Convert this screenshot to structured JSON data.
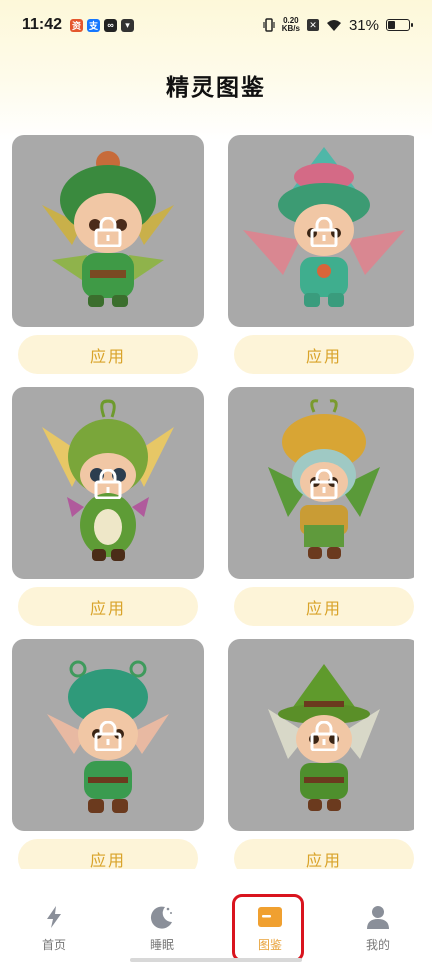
{
  "status_bar": {
    "time": "11:42",
    "net_speed_value": "0.20",
    "net_speed_unit": "KB/s",
    "battery": "31%",
    "battery_level": 0.31
  },
  "page": {
    "title": "精灵图鉴"
  },
  "cards": [
    {
      "name": "elf-green-lion-hat",
      "locked": true,
      "apply_label": "应用"
    },
    {
      "name": "elf-pink-wings",
      "locked": true,
      "apply_label": "应用"
    },
    {
      "name": "elf-big-ears-green",
      "locked": true,
      "apply_label": "应用"
    },
    {
      "name": "elf-yellow-helmet",
      "locked": true,
      "apply_label": "应用"
    },
    {
      "name": "elf-teal-antenna",
      "locked": true,
      "apply_label": "应用"
    },
    {
      "name": "elf-pointy-hat",
      "locked": true,
      "apply_label": "应用"
    }
  ],
  "tab_bar": {
    "active": "图鉴",
    "tabs": [
      {
        "label": "首页",
        "icon": "lightning-icon"
      },
      {
        "label": "睡眠",
        "icon": "moon-icon"
      },
      {
        "label": "图鉴",
        "icon": "card-icon"
      },
      {
        "label": "我的",
        "icon": "person-icon"
      }
    ]
  },
  "colors": {
    "accent": "#e8a23a",
    "apply_text": "#d9a32a",
    "apply_bg": "#fdf4d8",
    "card_bg": "#a9a9a9",
    "highlight": "#d9141e"
  }
}
